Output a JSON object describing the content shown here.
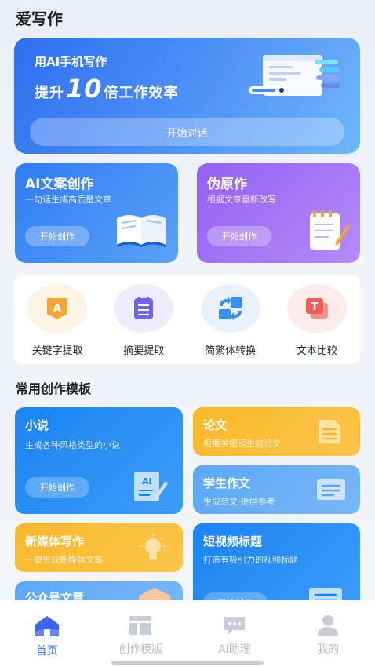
{
  "app": {
    "title": "爱写作"
  },
  "hero": {
    "subtitle": "用AI手机写作",
    "headline_prefix": "提升",
    "headline_number": "10",
    "headline_suffix": "倍工作效率",
    "button_label": "开始对话"
  },
  "features": [
    {
      "title": "AI文案创作",
      "desc": "一句话生成高质量文章",
      "button": "开始创作",
      "icon": "open-book-icon"
    },
    {
      "title": "伪原作",
      "desc": "根据文章重新改写",
      "button": "开始创作",
      "icon": "notepad-pencil-icon"
    }
  ],
  "tools": [
    {
      "label": "关键字提取",
      "icon": "keyword-a-icon",
      "color": "#f3a53a"
    },
    {
      "label": "摘要提取",
      "icon": "summary-list-icon",
      "color": "#6f63e8"
    },
    {
      "label": "简繁体转换",
      "icon": "convert-arrows-icon",
      "color": "#3b8ff0"
    },
    {
      "label": "文本比较",
      "icon": "compare-t-icon",
      "color": "#ee5f57"
    }
  ],
  "templates_section": {
    "title": "常用创作模板"
  },
  "templates": {
    "novel": {
      "title": "小说",
      "desc": "生成各种风格类型的小说",
      "button": "开始创作"
    },
    "paper": {
      "title": "论文",
      "desc": "根据关键词生成论文"
    },
    "essay": {
      "title": "学生作文",
      "desc": "生成范文 提供参考"
    },
    "media": {
      "title": "新媒体写作",
      "desc": "一键生成新媒体文章"
    },
    "video": {
      "title": "短视频标题",
      "desc": "打造有吸引力的视频标题",
      "button": "开始创作"
    },
    "official": {
      "title": "公众号文章"
    }
  },
  "bottom_nav": [
    {
      "label": "首页",
      "icon": "home-icon",
      "active": true
    },
    {
      "label": "创作模版",
      "icon": "template-icon",
      "active": false
    },
    {
      "label": "AI助理",
      "icon": "chat-bubble-icon",
      "active": false
    },
    {
      "label": "我的",
      "icon": "user-icon",
      "active": false
    }
  ],
  "colors": {
    "primary": "#2c6ff0",
    "purple": "#9460f3",
    "yellow": "#f9b829",
    "light_blue": "#65aef6"
  }
}
